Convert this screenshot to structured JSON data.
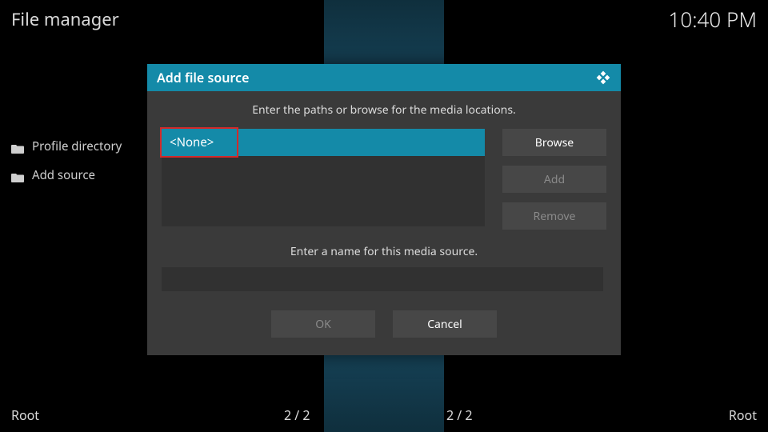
{
  "header": {
    "title": "File manager",
    "time": "10:40 PM"
  },
  "sidebar": {
    "items": [
      {
        "label": "Profile directory",
        "type": "folder"
      },
      {
        "label": "Add source",
        "type": "plus"
      }
    ]
  },
  "dialog": {
    "title": "Add file source",
    "instruction": "Enter the paths or browse for the media locations.",
    "paths": {
      "entry": "<None>",
      "buttons": {
        "browse": "Browse",
        "add": "Add",
        "remove": "Remove"
      }
    },
    "name_label": "Enter a name for this media source.",
    "name_value": "",
    "footer": {
      "ok": "OK",
      "cancel": "Cancel"
    }
  },
  "status": {
    "root_left": "Root",
    "count_left": "2 / 2",
    "count_right": "2 / 2",
    "root_right": "Root"
  }
}
